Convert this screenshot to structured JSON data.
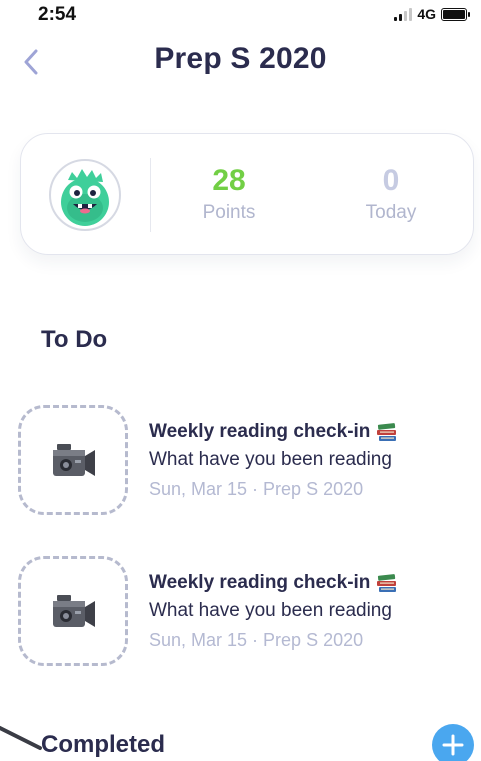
{
  "status_bar": {
    "time": "2:54",
    "network": "4G"
  },
  "header": {
    "title": "Prep S 2020",
    "back_icon": "chevron-left-icon"
  },
  "stats": {
    "points_value": "28",
    "points_label": "Points",
    "today_value": "0",
    "today_label": "Today",
    "avatar_icon": "green-monster-avatar-icon"
  },
  "sections": {
    "todo": "To Do",
    "completed": "Completed"
  },
  "tasks": [
    {
      "title": "Weekly reading check-in",
      "description": "What have you been reading",
      "meta": "Sun, Mar 15 · Prep S 2020",
      "thumb_icon": "video-camera-icon",
      "emoji_icon": "books-icon"
    },
    {
      "title": "Weekly reading check-in",
      "description": "What have you been reading",
      "meta": "Sun, Mar 15 · Prep S 2020",
      "thumb_icon": "video-camera-icon",
      "emoji_icon": "books-icon"
    }
  ],
  "fab": {
    "icon": "plus-icon"
  },
  "colors": {
    "title_text": "#2b2c4e",
    "points_green": "#72cf45",
    "muted": "#b1b6ce",
    "accent_blue": "#4aa7ef",
    "back_purple": "#9ea4d6"
  }
}
